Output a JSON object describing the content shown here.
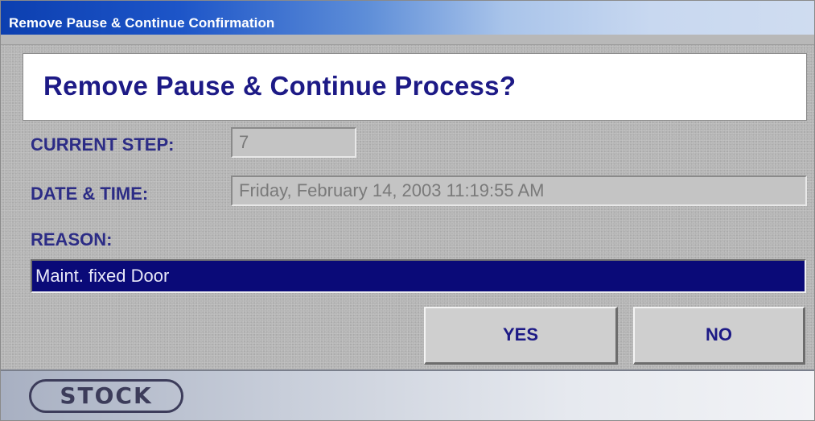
{
  "window": {
    "title": "Remove Pause & Continue Confirmation"
  },
  "dialog": {
    "heading": "Remove Pause & Continue Process?",
    "current_step": {
      "label": "CURRENT STEP:",
      "value": "7"
    },
    "date_time": {
      "label": "DATE & TIME:",
      "value": "Friday, February 14, 2003  11:19:55 AM"
    },
    "reason": {
      "label": "REASON:",
      "value": "Maint. fixed Door"
    },
    "buttons": {
      "yes_label": "YES",
      "no_label": "NO"
    }
  },
  "footer": {
    "logo_text": "STOCK"
  },
  "colors": {
    "title_bar": "#0c3fb0",
    "heading_text": "#1d1a86",
    "label_text": "#2c2c86",
    "reason_field_bg": "#0a0a78",
    "panel_bg": "#b5b5b5"
  }
}
